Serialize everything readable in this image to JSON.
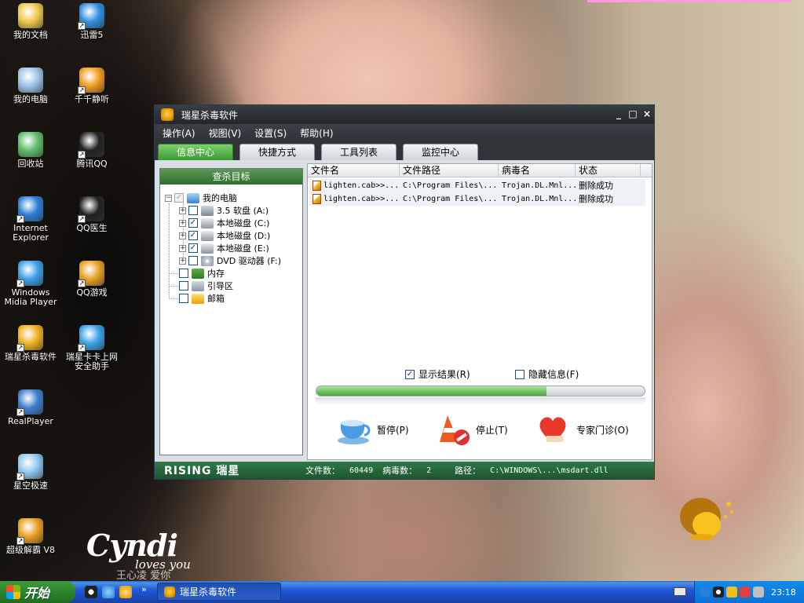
{
  "desktop": {
    "icons": [
      {
        "label": "我的文档",
        "icon": "folder-icon",
        "color": "#f2c94c"
      },
      {
        "label": "迅雷5",
        "icon": "thunder-icon",
        "color": "#2f8fe0"
      },
      {
        "label": "我的电脑",
        "icon": "computer-icon",
        "color": "#9fc3e8"
      },
      {
        "label": "千千静听",
        "icon": "music-player-icon",
        "color": "#f29b1f"
      },
      {
        "label": "回收站",
        "icon": "recycle-bin-icon",
        "color": "#5fbf6a"
      },
      {
        "label": "腾讯QQ",
        "icon": "qq-penguin-icon",
        "color": "#222222"
      },
      {
        "label": "Internet\nExplorer",
        "icon": "internet-explorer-icon",
        "color": "#2a7fd8"
      },
      {
        "label": "QQ医生",
        "icon": "qq-doctor-icon",
        "color": "#222222"
      },
      {
        "label": "Windows\nMidia Player",
        "icon": "media-player-icon",
        "color": "#3aa0e8"
      },
      {
        "label": "QQ游戏",
        "icon": "qq-game-icon",
        "color": "#e8a020"
      },
      {
        "label": "瑞星杀毒软件",
        "icon": "rising-antivirus-icon",
        "color": "#f0b020"
      },
      {
        "label": "瑞星卡卡上网\n安全助手",
        "icon": "rising-kaka-icon",
        "color": "#3aa0e8"
      },
      {
        "label": "RealPlayer",
        "icon": "realplayer-icon",
        "color": "#3b7fd0"
      },
      {
        "label": "星空极速",
        "icon": "dialer-icon",
        "color": "#8fc8f0"
      },
      {
        "label": "超级解霸 V8",
        "icon": "super-player-icon",
        "color": "#e8a020"
      }
    ]
  },
  "window": {
    "title": "瑞星杀毒软件",
    "controls": {
      "minimize": "_",
      "maximize": "□",
      "close": "×"
    },
    "menu": [
      "操作(A)",
      "视图(V)",
      "设置(S)",
      "帮助(H)"
    ],
    "tabs": [
      "信息中心",
      "快捷方式",
      "工具列表",
      "监控中心"
    ],
    "active_tab": "信息中心",
    "scan_target": {
      "header": "查杀目标",
      "root": {
        "label": "我的电脑",
        "checked": "partial"
      },
      "drives": [
        {
          "label": "3.5 软盘 (A:)",
          "checked": false,
          "icon": "floppy-icon"
        },
        {
          "label": "本地磁盘 (C:)",
          "checked": true,
          "icon": "hard-disk-icon"
        },
        {
          "label": "本地磁盘 (D:)",
          "checked": true,
          "icon": "hard-disk-icon"
        },
        {
          "label": "本地磁盘 (E:)",
          "checked": true,
          "icon": "hard-disk-icon"
        },
        {
          "label": "DVD 驱动器 (F:)",
          "checked": false,
          "icon": "dvd-icon"
        }
      ],
      "others": [
        {
          "label": "内存",
          "checked": false,
          "icon": "memory-icon"
        },
        {
          "label": "引导区",
          "checked": false,
          "icon": "boot-sector-icon"
        },
        {
          "label": "邮箱",
          "checked": false,
          "icon": "mailbox-icon"
        }
      ]
    },
    "results": {
      "columns": [
        "文件名",
        "文件路径",
        "病毒名",
        "状态"
      ],
      "rows": [
        {
          "file": "lighten.cab>>...",
          "path": "C:\\Program Files\\...",
          "virus": "Trojan.DL.Mnl...",
          "status": "删除成功"
        },
        {
          "file": "lighten.cab>>...",
          "path": "C:\\Program Files\\...",
          "virus": "Trojan.DL.Mnl...",
          "status": "删除成功"
        }
      ]
    },
    "options": {
      "show_results": {
        "label": "显示结果(R)",
        "checked": true
      },
      "hide_info": {
        "label": "隐藏信息(F)",
        "checked": false
      }
    },
    "progress": 0.7,
    "actions": {
      "pause": "暂停(P)",
      "stop": "停止(T)",
      "expert": "专家门诊(O)"
    },
    "status_bar": {
      "brand": "RISING 瑞星",
      "file_count_label": "文件数：",
      "file_count": "60449",
      "virus_count_label": "病毒数：",
      "virus_count": "2",
      "path_label": "路径：",
      "path": "C:\\WINDOWS\\...\\msdart.dll"
    }
  },
  "wallpaper_logo": {
    "main": "Cyndi",
    "sub": "loves you",
    "bottom": "王心凌 爱你"
  },
  "taskbar": {
    "start_label": "开始",
    "task_button": "瑞星杀毒软件",
    "clock": "23:18",
    "overflow": "»"
  },
  "colors": {
    "title_bar": "#2a2f34",
    "active_tab": "#3c9a34",
    "status_bar": "#1f5532",
    "progress": "#4aa53e",
    "taskbar": "#2157d7",
    "start_button": "#2f8a2f"
  }
}
